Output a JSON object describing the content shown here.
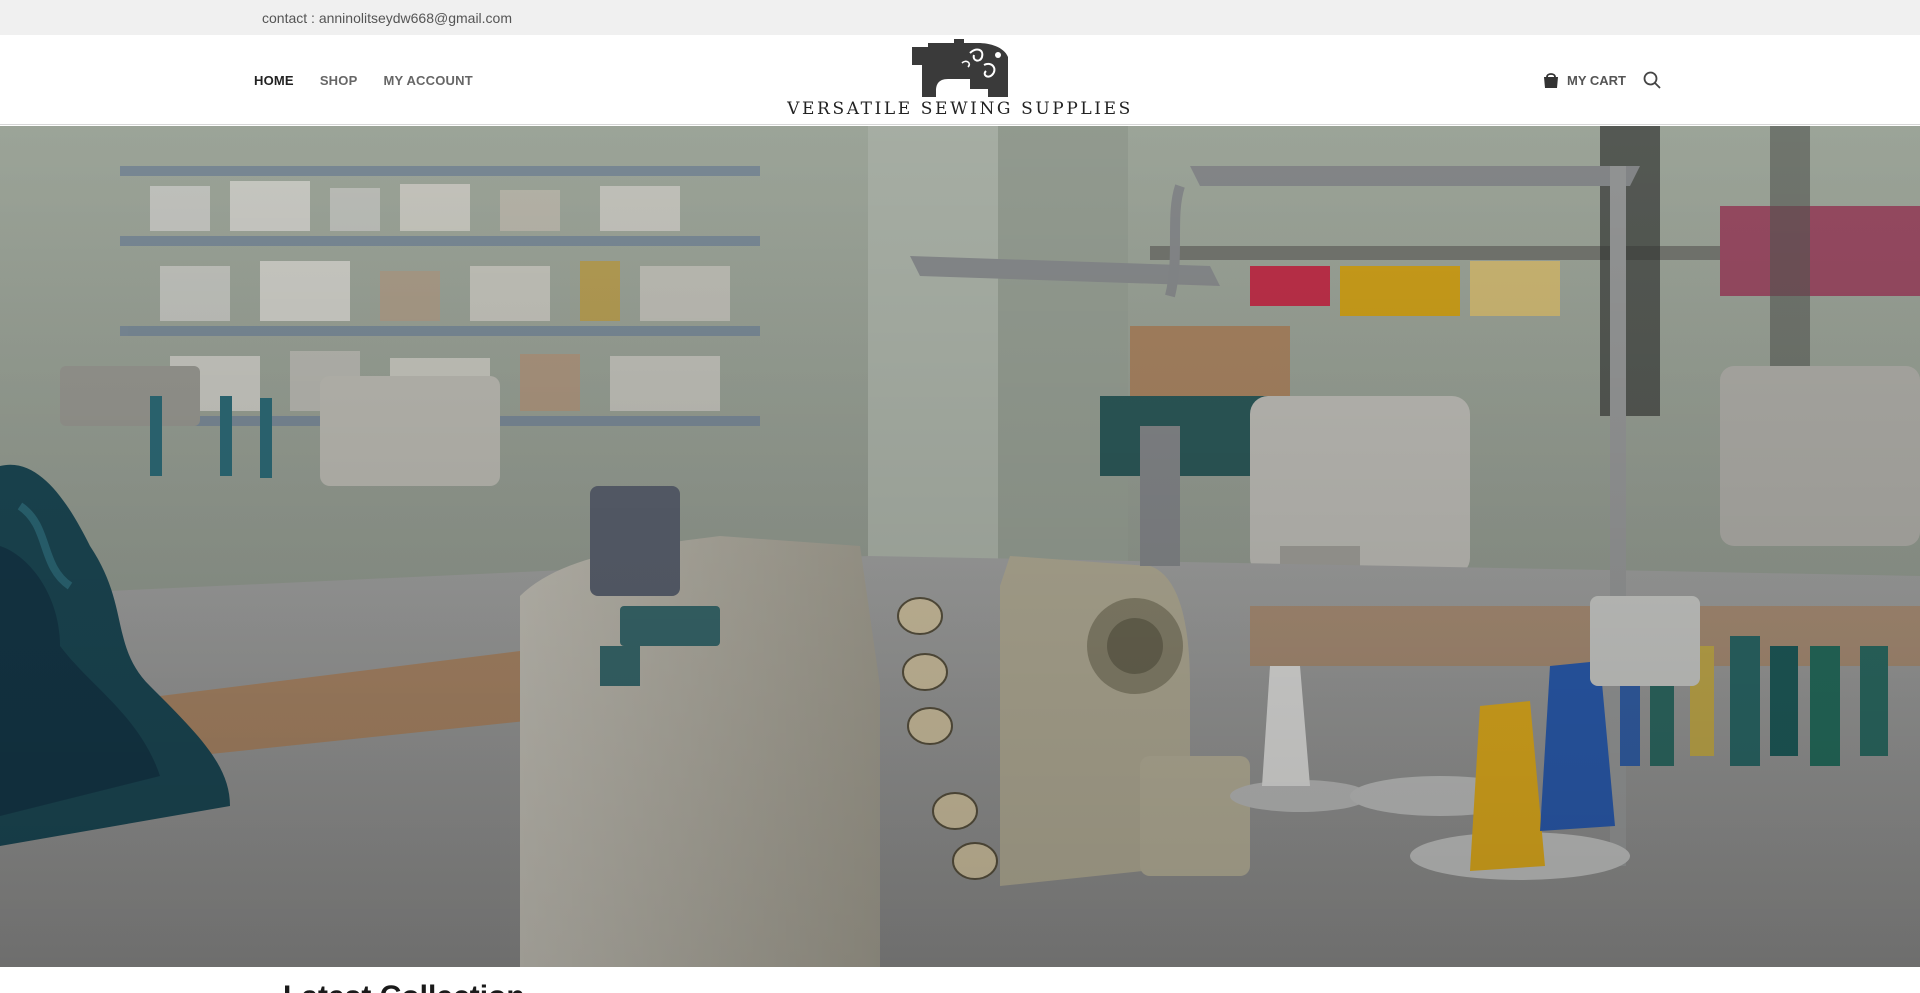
{
  "topbar": {
    "contact_label": "contact :",
    "contact_email": "anninolitseydw668@gmail.com"
  },
  "nav": {
    "items": [
      {
        "label": "HOME",
        "active": true
      },
      {
        "label": "SHOP",
        "active": false
      },
      {
        "label": "MY ACCOUNT",
        "active": false
      }
    ]
  },
  "logo": {
    "brand_name": "VERSATILE SEWING SUPPLIES",
    "icon": "sewing-machine-icon"
  },
  "tools": {
    "cart_label": "MY CART",
    "cart_icon": "shopping-bag-icon",
    "search_icon": "search-icon"
  },
  "hero": {
    "image": "sewing-workshop-photo"
  },
  "section": {
    "title": "Latest Collection"
  },
  "colors": {
    "topbar_bg": "#f0f0f0",
    "header_bg": "#ffffff",
    "text_dark": "#222222",
    "text_muted": "#666666",
    "spool_yellow": "#e7b21f",
    "spool_blue": "#2c5fb5",
    "fabric_teal": "#1c4a57"
  }
}
